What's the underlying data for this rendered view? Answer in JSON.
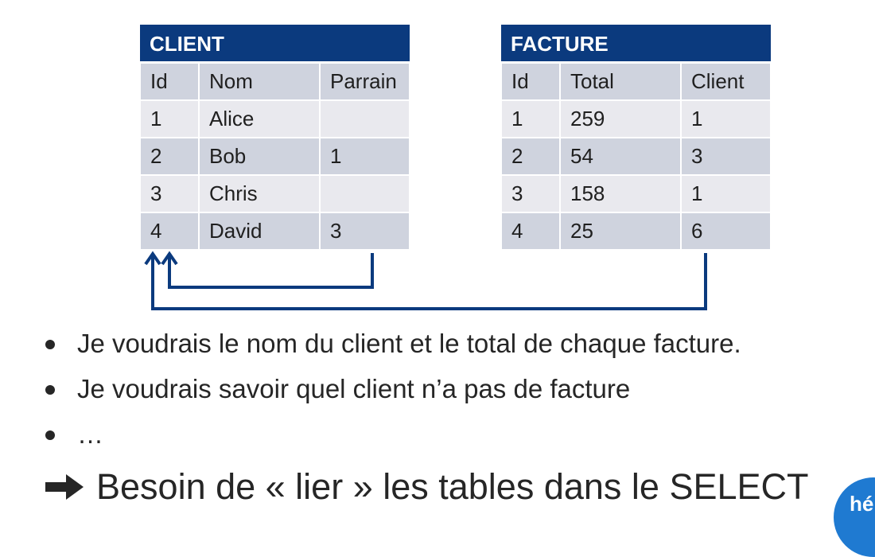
{
  "client_table": {
    "title": "CLIENT",
    "headers": [
      "Id",
      "Nom",
      "Parrain"
    ],
    "rows": [
      [
        "1",
        "Alice",
        ""
      ],
      [
        "2",
        "Bob",
        "1"
      ],
      [
        "3",
        "Chris",
        ""
      ],
      [
        "4",
        "David",
        "3"
      ]
    ]
  },
  "facture_table": {
    "title": "FACTURE",
    "headers": [
      "Id",
      "Total",
      "Client"
    ],
    "rows": [
      [
        "1",
        "259",
        "1"
      ],
      [
        "2",
        "54",
        "3"
      ],
      [
        "3",
        "158",
        "1"
      ],
      [
        "4",
        "25",
        "6"
      ]
    ]
  },
  "bullets": [
    "Je voudrais le nom du client et le total de chaque facture.",
    "Je voudrais savoir quel client n’a pas de facture",
    "…"
  ],
  "conclusion": "Besoin de « lier » les tables dans le SELECT",
  "logo_text": "hé",
  "colors": {
    "header_blue": "#0b3a7e",
    "arrow_blue": "#0b3a7e",
    "row_dark": "#cfd3de",
    "row_light": "#e9e9ee",
    "logo_blue": "#1f7ad1"
  }
}
